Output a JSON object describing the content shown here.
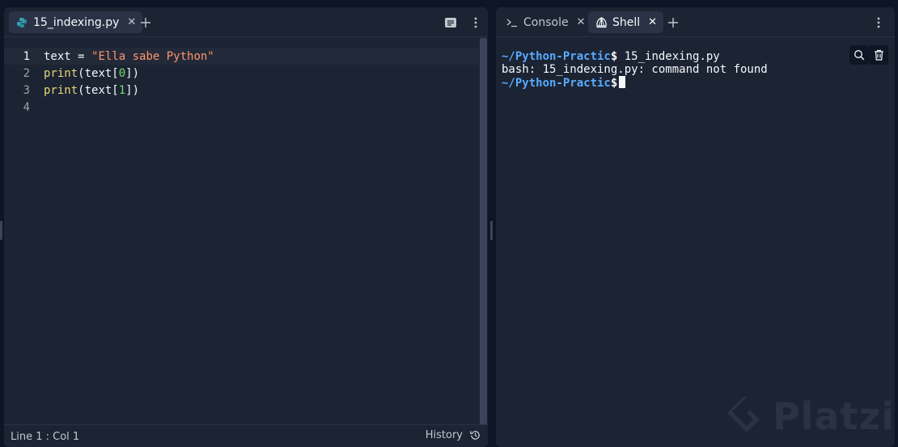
{
  "editor": {
    "tab": {
      "label": "15_indexing.py",
      "icon": "python-icon"
    },
    "lines": [
      {
        "number": "1",
        "tokens": [
          {
            "t": "text",
            "c": "plain"
          },
          {
            "t": " = ",
            "c": "op"
          },
          {
            "t": "\"Ella sabe Python\"",
            "c": "str"
          }
        ]
      },
      {
        "number": "2",
        "tokens": [
          {
            "t": "print",
            "c": "fn"
          },
          {
            "t": "(text[",
            "c": "plain"
          },
          {
            "t": "0",
            "c": "num"
          },
          {
            "t": "])",
            "c": "plain"
          }
        ]
      },
      {
        "number": "3",
        "tokens": [
          {
            "t": "print",
            "c": "fn"
          },
          {
            "t": "(text[",
            "c": "plain"
          },
          {
            "t": "1",
            "c": "num"
          },
          {
            "t": "])",
            "c": "plain"
          }
        ]
      },
      {
        "number": "4",
        "tokens": []
      }
    ],
    "status": {
      "position": "Line 1 : Col 1",
      "history_label": "History"
    }
  },
  "right": {
    "tabs": [
      {
        "label": "Console",
        "icon": "terminal-icon",
        "active": false
      },
      {
        "label": "Shell",
        "icon": "shell-icon",
        "active": true
      }
    ],
    "shell": {
      "line1_prompt": "~/Python-Practic",
      "line1_dollar": "$",
      "line1_cmd": " 15_indexing.py",
      "line2": "bash: 15_indexing.py: command not found",
      "line3_prompt": "~/Python-Practic",
      "line3_dollar": "$"
    }
  },
  "watermark": {
    "text": "Platzi"
  },
  "colors": {
    "background": "#0e1525",
    "panel": "#1c2333",
    "prompt": "#57abff",
    "string": "#ff9567",
    "function": "#e4d776",
    "number": "#75d968"
  }
}
